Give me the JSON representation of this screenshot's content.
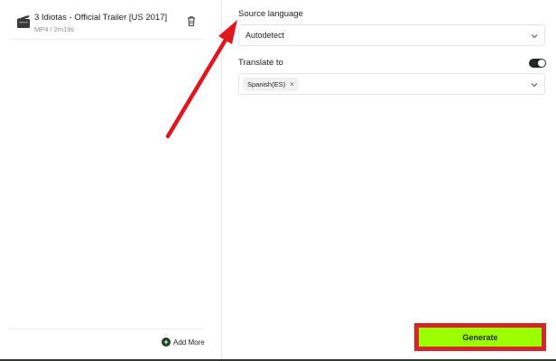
{
  "file": {
    "name": "3 Idiotas - Official Trailer [US 2017]",
    "meta": "MP4 / 2m19s",
    "icon": "clapperboard-icon"
  },
  "left_footer": {
    "add_more_label": "Add More",
    "add_more_symbol": "+"
  },
  "source_language": {
    "label": "Source language",
    "value": "Autodetect"
  },
  "translate_to": {
    "label": "Translate to",
    "toggle_on": true,
    "chips": [
      {
        "label": "Spanish(ES)",
        "remove_symbol": "×"
      }
    ]
  },
  "generate": {
    "label": "Generate"
  },
  "colors": {
    "accent_green": "#9cff00",
    "highlight_red": "#d4262a",
    "dark": "#1f2a22"
  }
}
